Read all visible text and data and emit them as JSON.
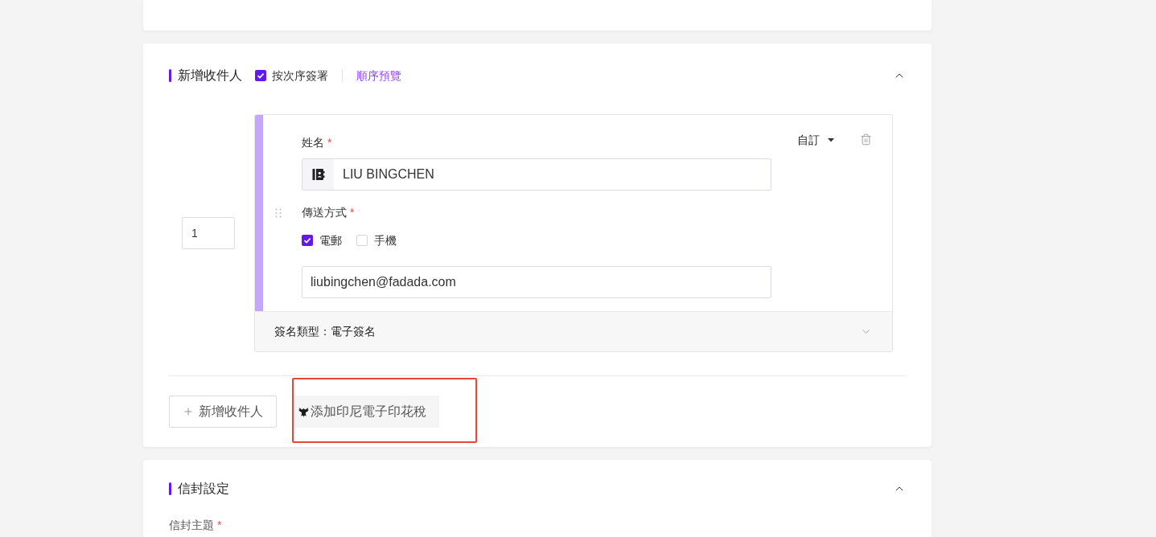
{
  "recipients_section": {
    "title": "新增收件人",
    "expanded": true,
    "sequential_signing": {
      "label": "按次序簽署",
      "checked": true
    },
    "preview_link": "順序預覽",
    "recipients": [
      {
        "order": "1",
        "role_menu": "自訂",
        "name_label": {
          "text": "姓名",
          "mark": "*"
        },
        "name_value": "LIU BINGCHEN",
        "delivery_label": {
          "text": "傳送方式",
          "mark": "*"
        },
        "delivery_options": [
          {
            "label": "電郵",
            "checked": true
          },
          {
            "label": "手機",
            "checked": false
          }
        ],
        "email_value": "liubingchen@fadada.com",
        "signature_type": "簽名類型：電子簽名",
        "footer_expanded": false
      }
    ],
    "buttons": [
      {
        "kind": "add",
        "label": "新增收件人",
        "highlighted": false
      },
      {
        "kind": "stamp",
        "label": "添加印尼電子印花稅",
        "highlighted": true
      }
    ]
  },
  "envelope_section": {
    "title": "信封設定",
    "expanded": true,
    "fields": [
      {
        "label": {
          "text": "信封主題",
          "mark": "*"
        }
      }
    ]
  }
}
